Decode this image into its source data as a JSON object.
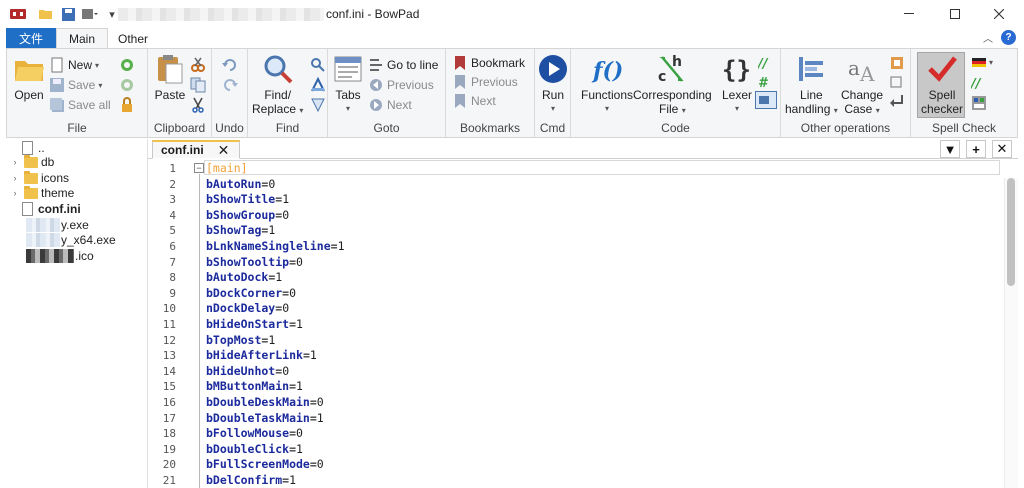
{
  "window": {
    "title": "conf.ini - BowPad",
    "controls": [
      "minimize",
      "maximize",
      "close"
    ]
  },
  "ribbon_tabs": [
    {
      "label": "文件"
    },
    {
      "label": "Main"
    },
    {
      "label": "Other"
    }
  ],
  "ribbon": {
    "file": {
      "label": "File",
      "open": "Open",
      "new": "New",
      "save": "Save",
      "save_all": "Save all"
    },
    "clipboard": {
      "label": "Clipboard",
      "paste": "Paste"
    },
    "undo": {
      "label": "Undo"
    },
    "find": {
      "label": "Find",
      "find_replace_1": "Find/",
      "find_replace_2": "Replace"
    },
    "goto": {
      "label": "Goto",
      "tabs": "Tabs",
      "go_to_line": "Go to line",
      "previous": "Previous",
      "next": "Next"
    },
    "bookmarks": {
      "label": "Bookmarks",
      "bookmark": "Bookmark",
      "previous": "Previous",
      "next": "Next"
    },
    "cmd": {
      "label": "Cmd",
      "run": "Run"
    },
    "code": {
      "label": "Code",
      "functions": "Functions",
      "corr_1": "Corresponding",
      "corr_2": "File",
      "lexer": "Lexer"
    },
    "other_ops": {
      "label": "Other operations",
      "line_1": "Line",
      "line_2": "handling",
      "case_1": "Change",
      "case_2": "Case"
    },
    "spell": {
      "label": "Spell Check",
      "spell_1": "Spell",
      "spell_2": "checker"
    }
  },
  "file_tree": [
    {
      "name": "..",
      "type": "file",
      "has_caret": false
    },
    {
      "name": "db",
      "type": "folder",
      "has_caret": true
    },
    {
      "name": "icons",
      "type": "folder",
      "has_caret": true
    },
    {
      "name": "theme",
      "type": "folder",
      "has_caret": true
    },
    {
      "name": "conf.ini",
      "type": "file",
      "has_caret": false,
      "bold": true
    },
    {
      "name": "y.exe",
      "type": "file-blurred"
    },
    {
      "name": "y_x64.exe",
      "type": "file-blurred"
    },
    {
      "name": ".ico",
      "type": "file-blurred-dark"
    }
  ],
  "document_tab": {
    "name": "conf.ini",
    "close": "✕"
  },
  "tab_tools": [
    "▼",
    "+",
    "✕"
  ],
  "editor": {
    "lines": [
      {
        "n": "1",
        "key": "[main]",
        "value": "",
        "section": true
      },
      {
        "n": "2",
        "key": "bAutoRun",
        "value": "0"
      },
      {
        "n": "3",
        "key": "bShowTitle",
        "value": "1"
      },
      {
        "n": "4",
        "key": "bShowGroup",
        "value": "0"
      },
      {
        "n": "5",
        "key": "bShowTag",
        "value": "1"
      },
      {
        "n": "6",
        "key": "bLnkNameSingleline",
        "value": "1"
      },
      {
        "n": "7",
        "key": "bShowTooltip",
        "value": "0"
      },
      {
        "n": "8",
        "key": "bAutoDock",
        "value": "1"
      },
      {
        "n": "9",
        "key": "bDockCorner",
        "value": "0"
      },
      {
        "n": "10",
        "key": "nDockDelay",
        "value": "0"
      },
      {
        "n": "11",
        "key": "bHideOnStart",
        "value": "1"
      },
      {
        "n": "12",
        "key": "bTopMost",
        "value": "1"
      },
      {
        "n": "13",
        "key": "bHideAfterLink",
        "value": "1"
      },
      {
        "n": "14",
        "key": "bHideUnhot",
        "value": "0"
      },
      {
        "n": "15",
        "key": "bMButtonMain",
        "value": "1"
      },
      {
        "n": "16",
        "key": "bDoubleDeskMain",
        "value": "0"
      },
      {
        "n": "17",
        "key": "bDoubleTaskMain",
        "value": "1"
      },
      {
        "n": "18",
        "key": "bFollowMouse",
        "value": "0"
      },
      {
        "n": "19",
        "key": "bDoubleClick",
        "value": "1"
      },
      {
        "n": "20",
        "key": "bFullScreenMode",
        "value": "0"
      },
      {
        "n": "21",
        "key": "bDelConfirm",
        "value": "1"
      }
    ]
  },
  "colors": {
    "file_tab": "#1f6fc6",
    "keyword": "#1b2a9c",
    "section": "#f0a33a",
    "folder": "#f0c24b",
    "help": "#2a6ad3"
  }
}
